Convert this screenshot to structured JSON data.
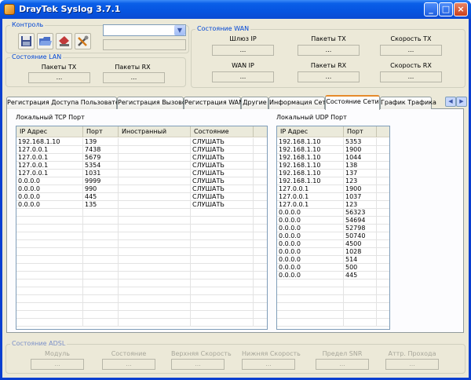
{
  "window": {
    "title": "DrayTek Syslog 3.7.1"
  },
  "control": {
    "legend": "Контроль",
    "combo_value": ""
  },
  "lan": {
    "legend": "Состояние LAN",
    "labels": [
      "Пакеты TX",
      "Пакеты RX"
    ],
    "values": [
      "...",
      "..."
    ]
  },
  "wan": {
    "legend": "Состояние WAN",
    "labels": [
      "Шлюз IP",
      "Пакеты TX",
      "Скорость TX",
      "WAN IP",
      "Пакеты RX",
      "Скорость RX"
    ],
    "values": [
      "...",
      "...",
      "...",
      "...",
      "...",
      "..."
    ]
  },
  "tabs": [
    "Регистрация Доступа Пользователя",
    "Регистрация Вызовов",
    "Регистрация WAN",
    "Другие",
    "Информация Сети",
    "Состояние Сети",
    "График Трафика"
  ],
  "tcp": {
    "title": "Локальный TCP Порт",
    "headers": [
      "IP Адрес",
      "Порт",
      "Иностранный",
      "Состояние"
    ],
    "rows": [
      [
        "192.168.1.10",
        "139",
        "",
        "СЛУШАТЬ"
      ],
      [
        "127.0.0.1",
        "7438",
        "",
        "СЛУШАТЬ"
      ],
      [
        "127.0.0.1",
        "5679",
        "",
        "СЛУШАТЬ"
      ],
      [
        "127.0.0.1",
        "5354",
        "",
        "СЛУШАТЬ"
      ],
      [
        "127.0.0.1",
        "1031",
        "",
        "СЛУШАТЬ"
      ],
      [
        "0.0.0.0",
        "9999",
        "",
        "СЛУШАТЬ"
      ],
      [
        "0.0.0.0",
        "990",
        "",
        "СЛУШАТЬ"
      ],
      [
        "0.0.0.0",
        "445",
        "",
        "СЛУШАТЬ"
      ],
      [
        "0.0.0.0",
        "135",
        "",
        "СЛУШАТЬ"
      ]
    ]
  },
  "udp": {
    "title": "Локальный UDP Порт",
    "headers": [
      "IP Адрес",
      "Порт"
    ],
    "rows": [
      [
        "192.168.1.10",
        "5353"
      ],
      [
        "192.168.1.10",
        "1900"
      ],
      [
        "192.168.1.10",
        "1044"
      ],
      [
        "192.168.1.10",
        "138"
      ],
      [
        "192.168.1.10",
        "137"
      ],
      [
        "192.168.1.10",
        "123"
      ],
      [
        "127.0.0.1",
        "1900"
      ],
      [
        "127.0.0.1",
        "1037"
      ],
      [
        "127.0.0.1",
        "123"
      ],
      [
        "0.0.0.0",
        "56323"
      ],
      [
        "0.0.0.0",
        "54694"
      ],
      [
        "0.0.0.0",
        "52798"
      ],
      [
        "0.0.0.0",
        "50740"
      ],
      [
        "0.0.0.0",
        "4500"
      ],
      [
        "0.0.0.0",
        "1028"
      ],
      [
        "0.0.0.0",
        "514"
      ],
      [
        "0.0.0.0",
        "500"
      ],
      [
        "0.0.0.0",
        "445"
      ]
    ]
  },
  "adsl": {
    "legend": "Состояние ADSL",
    "labels": [
      "Модуль",
      "Состояние",
      "Верхняя Скорость",
      "Нижняя Скорость",
      "Предел SNR",
      "Аттр. Прохода"
    ],
    "values": [
      "...",
      "...",
      "...",
      "...",
      "...",
      "..."
    ]
  }
}
